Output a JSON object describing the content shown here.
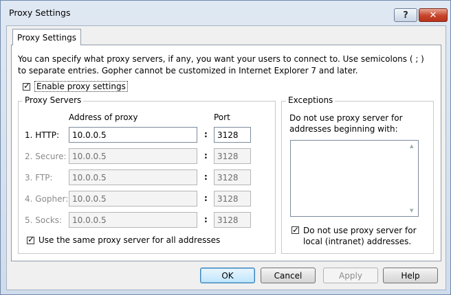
{
  "window": {
    "title": "Proxy Settings",
    "help_button": "?",
    "close_button": "✕"
  },
  "tab": {
    "label": "Proxy Settings"
  },
  "description": "You can specify what proxy servers, if any, you want your users to connect to. Use semicolons ( ; ) to separate entries. Gopher cannot be customized in Internet Explorer 7 and later.",
  "enable": {
    "label": "Enable proxy settings",
    "checked": true
  },
  "proxy_servers": {
    "group_title": "Proxy Servers",
    "address_header": "Address of proxy",
    "port_header": "Port",
    "separator": ":",
    "rows": [
      {
        "label": "1. HTTP:",
        "address": "10.0.0.5",
        "port": "3128",
        "enabled": true
      },
      {
        "label": "2. Secure:",
        "address": "10.0.0.5",
        "port": "3128",
        "enabled": false
      },
      {
        "label": "3. FTP:",
        "address": "10.0.0.5",
        "port": "3128",
        "enabled": false
      },
      {
        "label": "4. Gopher:",
        "address": "10.0.0.5",
        "port": "3128",
        "enabled": false
      },
      {
        "label": "5. Socks:",
        "address": "10.0.0.5",
        "port": "3128",
        "enabled": false
      }
    ],
    "same_proxy": {
      "label": "Use the same proxy server for all addresses",
      "checked": true
    }
  },
  "exceptions": {
    "group_title": "Exceptions",
    "text": "Do not use proxy server for addresses beginning with:",
    "list_value": "",
    "local": {
      "label": "Do not use proxy server for local (intranet) addresses.",
      "checked": true
    }
  },
  "buttons": {
    "ok": "OK",
    "cancel": "Cancel",
    "apply": "Apply",
    "help": "Help"
  }
}
